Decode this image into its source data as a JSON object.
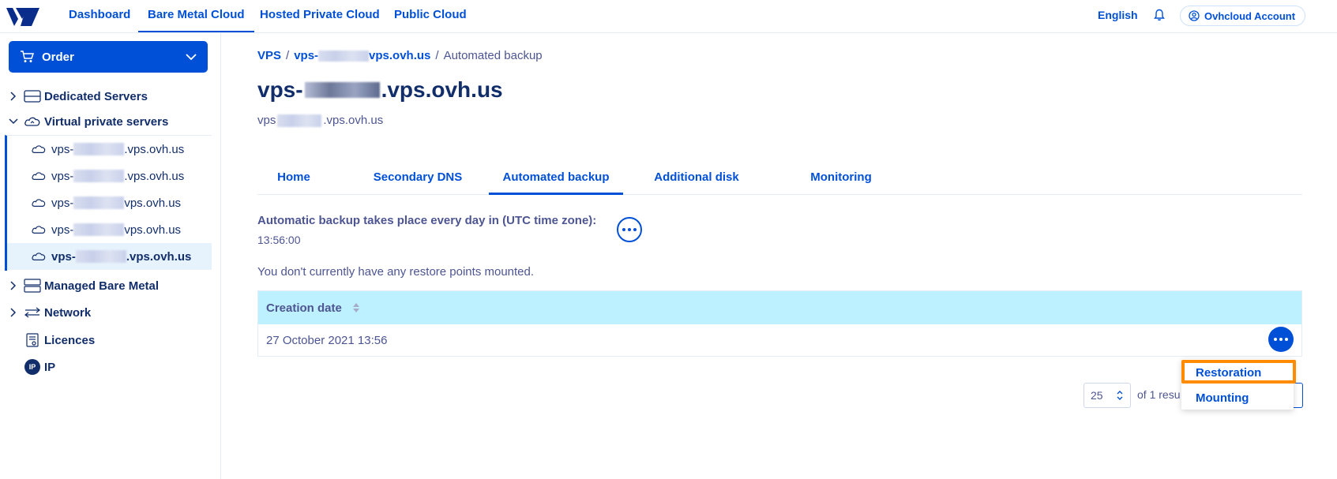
{
  "topnav": {
    "items": [
      "Dashboard",
      "Bare Metal Cloud",
      "Hosted Private Cloud",
      "Public Cloud"
    ],
    "active": "Bare Metal Cloud",
    "language": "English",
    "account": "Ovhcloud Account"
  },
  "sidebar": {
    "order_label": "Order",
    "dedicated": "Dedicated Servers",
    "vps_group": "Virtual private servers",
    "vps_prefix": "vps-",
    "vps_suffix": ".vps.ovh.us",
    "vps_suffix_alt": "vps.ovh.us",
    "managed": "Managed Bare Metal",
    "network": "Network",
    "licences": "Licences",
    "ip": "IP",
    "ip_badge": "IP"
  },
  "breadcrumb": {
    "root": "VPS",
    "sep": "/",
    "server_prefix": "vps-",
    "server_suffix": "vps.ovh.us",
    "current": "Automated backup"
  },
  "header": {
    "title_prefix": "vps-",
    "title_suffix": ".vps.ovh.us",
    "subtitle_prefix": "vps",
    "subtitle_suffix": ".vps.ovh.us"
  },
  "tabs": [
    "Home",
    "Secondary DNS",
    "Automated backup",
    "Additional disk",
    "Monitoring"
  ],
  "backup": {
    "schedule_label": "Automatic backup takes place every day in (UTC time zone):",
    "schedule_time": "13:56:00",
    "notice": "You don't currently have any restore points mounted."
  },
  "table": {
    "column": "Creation date",
    "rows": [
      "27 October 2021 13:56"
    ]
  },
  "pagination": {
    "per_page": "25",
    "results": "of 1 resu"
  },
  "menu": {
    "items": [
      "Restoration",
      "Mounting"
    ]
  }
}
